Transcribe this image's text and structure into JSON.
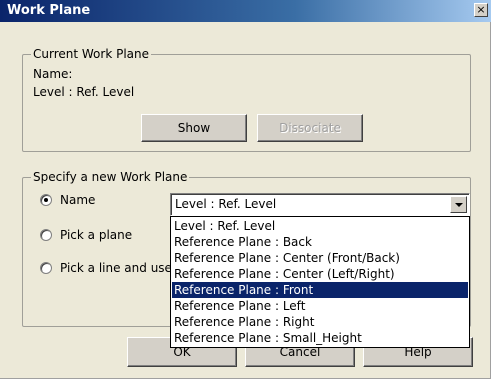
{
  "window": {
    "title": "Work Plane",
    "close_glyph": "×"
  },
  "current": {
    "legend": "Current Work Plane",
    "name_label": "Name:",
    "name_value": "Level : Ref. Level",
    "show_label": "Show",
    "dissociate_label": "Dissociate"
  },
  "specify": {
    "legend": "Specify a new Work Plane",
    "options": [
      {
        "label": "Name",
        "selected": true
      },
      {
        "label": "Pick a plane",
        "selected": false
      },
      {
        "label": "Pick a line and use",
        "selected": false
      }
    ],
    "combo_value": "Level : Ref. Level",
    "dropdown_items": [
      "Level : Ref. Level",
      "Reference Plane : Back",
      "Reference Plane : Center (Front/Back)",
      "Reference Plane : Center (Left/Right)",
      "Reference Plane : Front",
      "Reference Plane : Left",
      "Reference Plane : Right",
      "Reference Plane : Small_Height"
    ],
    "highlighted_item": "Reference Plane : Front"
  },
  "buttons": {
    "ok": "OK",
    "cancel": "Cancel",
    "help": "Help"
  }
}
